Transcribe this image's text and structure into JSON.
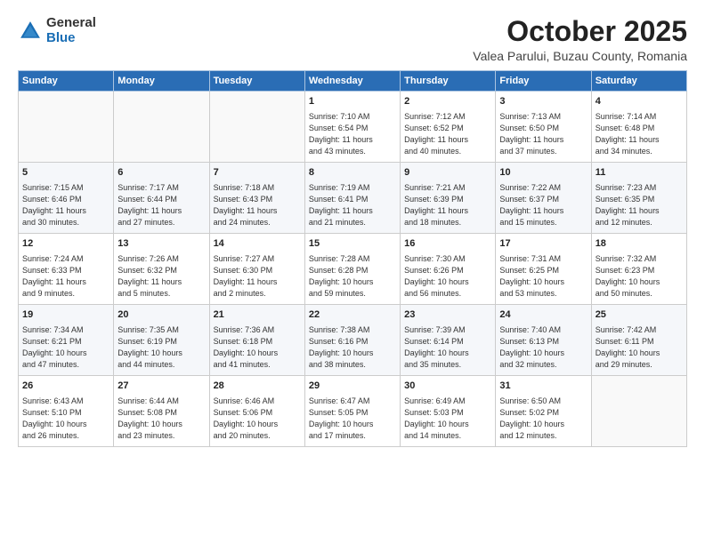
{
  "header": {
    "logo_general": "General",
    "logo_blue": "Blue",
    "title": "October 2025",
    "location": "Valea Parului, Buzau County, Romania"
  },
  "days_of_week": [
    "Sunday",
    "Monday",
    "Tuesday",
    "Wednesday",
    "Thursday",
    "Friday",
    "Saturday"
  ],
  "weeks": [
    [
      {
        "day": "",
        "info": ""
      },
      {
        "day": "",
        "info": ""
      },
      {
        "day": "",
        "info": ""
      },
      {
        "day": "1",
        "info": "Sunrise: 7:10 AM\nSunset: 6:54 PM\nDaylight: 11 hours\nand 43 minutes."
      },
      {
        "day": "2",
        "info": "Sunrise: 7:12 AM\nSunset: 6:52 PM\nDaylight: 11 hours\nand 40 minutes."
      },
      {
        "day": "3",
        "info": "Sunrise: 7:13 AM\nSunset: 6:50 PM\nDaylight: 11 hours\nand 37 minutes."
      },
      {
        "day": "4",
        "info": "Sunrise: 7:14 AM\nSunset: 6:48 PM\nDaylight: 11 hours\nand 34 minutes."
      }
    ],
    [
      {
        "day": "5",
        "info": "Sunrise: 7:15 AM\nSunset: 6:46 PM\nDaylight: 11 hours\nand 30 minutes."
      },
      {
        "day": "6",
        "info": "Sunrise: 7:17 AM\nSunset: 6:44 PM\nDaylight: 11 hours\nand 27 minutes."
      },
      {
        "day": "7",
        "info": "Sunrise: 7:18 AM\nSunset: 6:43 PM\nDaylight: 11 hours\nand 24 minutes."
      },
      {
        "day": "8",
        "info": "Sunrise: 7:19 AM\nSunset: 6:41 PM\nDaylight: 11 hours\nand 21 minutes."
      },
      {
        "day": "9",
        "info": "Sunrise: 7:21 AM\nSunset: 6:39 PM\nDaylight: 11 hours\nand 18 minutes."
      },
      {
        "day": "10",
        "info": "Sunrise: 7:22 AM\nSunset: 6:37 PM\nDaylight: 11 hours\nand 15 minutes."
      },
      {
        "day": "11",
        "info": "Sunrise: 7:23 AM\nSunset: 6:35 PM\nDaylight: 11 hours\nand 12 minutes."
      }
    ],
    [
      {
        "day": "12",
        "info": "Sunrise: 7:24 AM\nSunset: 6:33 PM\nDaylight: 11 hours\nand 9 minutes."
      },
      {
        "day": "13",
        "info": "Sunrise: 7:26 AM\nSunset: 6:32 PM\nDaylight: 11 hours\nand 5 minutes."
      },
      {
        "day": "14",
        "info": "Sunrise: 7:27 AM\nSunset: 6:30 PM\nDaylight: 11 hours\nand 2 minutes."
      },
      {
        "day": "15",
        "info": "Sunrise: 7:28 AM\nSunset: 6:28 PM\nDaylight: 10 hours\nand 59 minutes."
      },
      {
        "day": "16",
        "info": "Sunrise: 7:30 AM\nSunset: 6:26 PM\nDaylight: 10 hours\nand 56 minutes."
      },
      {
        "day": "17",
        "info": "Sunrise: 7:31 AM\nSunset: 6:25 PM\nDaylight: 10 hours\nand 53 minutes."
      },
      {
        "day": "18",
        "info": "Sunrise: 7:32 AM\nSunset: 6:23 PM\nDaylight: 10 hours\nand 50 minutes."
      }
    ],
    [
      {
        "day": "19",
        "info": "Sunrise: 7:34 AM\nSunset: 6:21 PM\nDaylight: 10 hours\nand 47 minutes."
      },
      {
        "day": "20",
        "info": "Sunrise: 7:35 AM\nSunset: 6:19 PM\nDaylight: 10 hours\nand 44 minutes."
      },
      {
        "day": "21",
        "info": "Sunrise: 7:36 AM\nSunset: 6:18 PM\nDaylight: 10 hours\nand 41 minutes."
      },
      {
        "day": "22",
        "info": "Sunrise: 7:38 AM\nSunset: 6:16 PM\nDaylight: 10 hours\nand 38 minutes."
      },
      {
        "day": "23",
        "info": "Sunrise: 7:39 AM\nSunset: 6:14 PM\nDaylight: 10 hours\nand 35 minutes."
      },
      {
        "day": "24",
        "info": "Sunrise: 7:40 AM\nSunset: 6:13 PM\nDaylight: 10 hours\nand 32 minutes."
      },
      {
        "day": "25",
        "info": "Sunrise: 7:42 AM\nSunset: 6:11 PM\nDaylight: 10 hours\nand 29 minutes."
      }
    ],
    [
      {
        "day": "26",
        "info": "Sunrise: 6:43 AM\nSunset: 5:10 PM\nDaylight: 10 hours\nand 26 minutes."
      },
      {
        "day": "27",
        "info": "Sunrise: 6:44 AM\nSunset: 5:08 PM\nDaylight: 10 hours\nand 23 minutes."
      },
      {
        "day": "28",
        "info": "Sunrise: 6:46 AM\nSunset: 5:06 PM\nDaylight: 10 hours\nand 20 minutes."
      },
      {
        "day": "29",
        "info": "Sunrise: 6:47 AM\nSunset: 5:05 PM\nDaylight: 10 hours\nand 17 minutes."
      },
      {
        "day": "30",
        "info": "Sunrise: 6:49 AM\nSunset: 5:03 PM\nDaylight: 10 hours\nand 14 minutes."
      },
      {
        "day": "31",
        "info": "Sunrise: 6:50 AM\nSunset: 5:02 PM\nDaylight: 10 hours\nand 12 minutes."
      },
      {
        "day": "",
        "info": ""
      }
    ]
  ]
}
